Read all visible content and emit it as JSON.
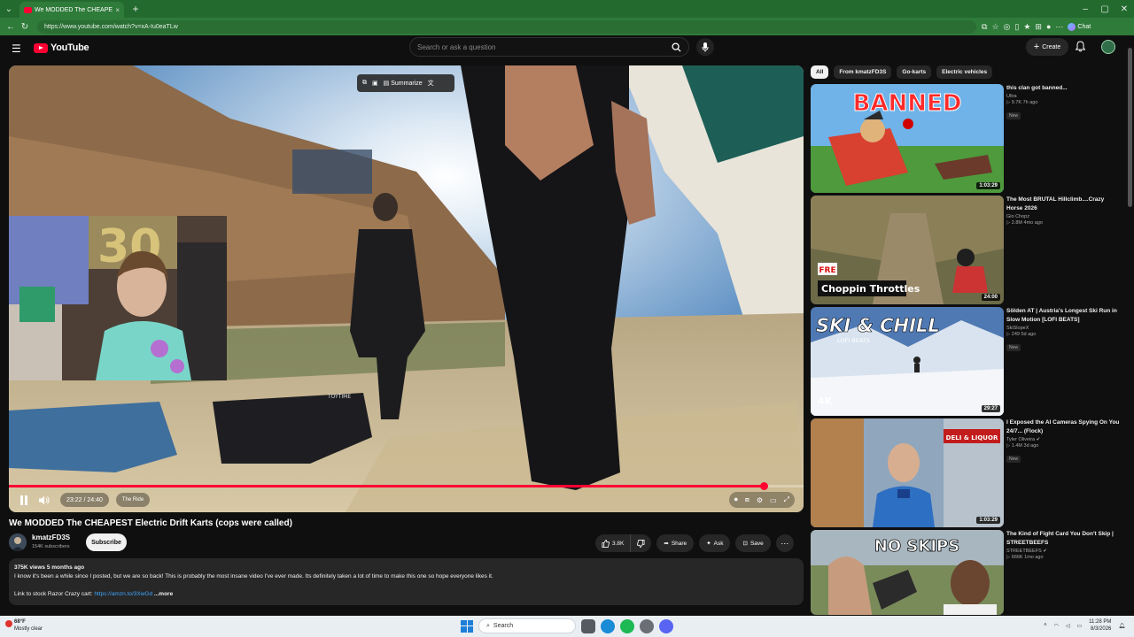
{
  "browser": {
    "tab_title": "We MODDED The CHEAPEST",
    "url": "https://www.youtube.com/watch?v=xA-Iu0eaTLw",
    "chat_label": "Chat"
  },
  "header": {
    "logo_text": "YouTube",
    "search_placeholder": "Search or ask a question",
    "create_label": "Create"
  },
  "player": {
    "time": "23:22 / 24:40",
    "chapter": "The Ride",
    "progress_fraction": 0.95,
    "toolbar_summarize": "Summarize",
    "watermark": "TOYTIME"
  },
  "video": {
    "title": "We MODDED The CHEAPEST Electric Drift Karts (cops were called)",
    "channel": "kmatzFD3S",
    "subscribers": "154K subscribers",
    "subscribe_label": "Subscribe",
    "likes": "3.8K",
    "share_label": "Share",
    "ask_label": "Ask",
    "save_label": "Save",
    "stats": "375K views  5 months ago",
    "description": "I know it's been a while since I posted, but we are so back! This is probably the most insane video I've ever made. Its definitely taken a lot of time to make this one so hope everyone likes it.",
    "link_prefix": "Link to stock Razor Crazy cart:",
    "link_url": "https://amzn.to/3XwGd",
    "more_label": "...more"
  },
  "chips": [
    "All",
    "From kmatzFD3S",
    "Go-karts",
    "Electric vehicles"
  ],
  "recommendations": [
    {
      "title": "this clan got banned...",
      "channel": "Ultra",
      "meta": "▷ 9.7K  7h ago",
      "badge": "New",
      "duration": "1:03:29",
      "thumb_text": "BANNED"
    },
    {
      "title": "The Most BRUTAL Hillclimb....Crazy Horse 2026",
      "channel": "Gio Chopz",
      "meta": "▷ 2.8M  4mo ago",
      "badge": "",
      "duration": "24:00",
      "thumb_text": "Choppin Throttles",
      "thumb_tag": "FRE"
    },
    {
      "title": "Sölden AT | Austria's Longest Ski Run in Slow Motion [LOFI BEATS]",
      "channel": "SkiSlopeX",
      "meta": "▷ 249  5d ago",
      "badge": "New",
      "duration": "29:27",
      "thumb_text": "SKI & CHILL",
      "thumb_sub": "LOFI BEATS",
      "thumb_tag": "4K"
    },
    {
      "title": "I Exposed the AI Cameras Spying On You 24/7... (Flock)",
      "channel": "Tyler Oliveira",
      "meta": "▷ 1.4M  3d ago",
      "badge": "New",
      "duration": "1:03:29",
      "thumb_text": "DELI & LIQUOR"
    },
    {
      "title": "The Kind of Fight Card You Don't Skip | STREETBEEFS",
      "channel": "STREETBEEFS",
      "meta": "▷ 666K  1mo ago",
      "badge": "",
      "duration": "",
      "thumb_text": "NO SKIPS"
    }
  ],
  "taskbar": {
    "weather_temp": "68°F",
    "weather_desc": "Mostly clear",
    "search_label": "Search",
    "time": "11:28 PM",
    "date": "8/3/2026"
  },
  "colors": {
    "accent": "#ff0033",
    "browser_frame": "#236a2e",
    "link": "#3ea6ff"
  }
}
